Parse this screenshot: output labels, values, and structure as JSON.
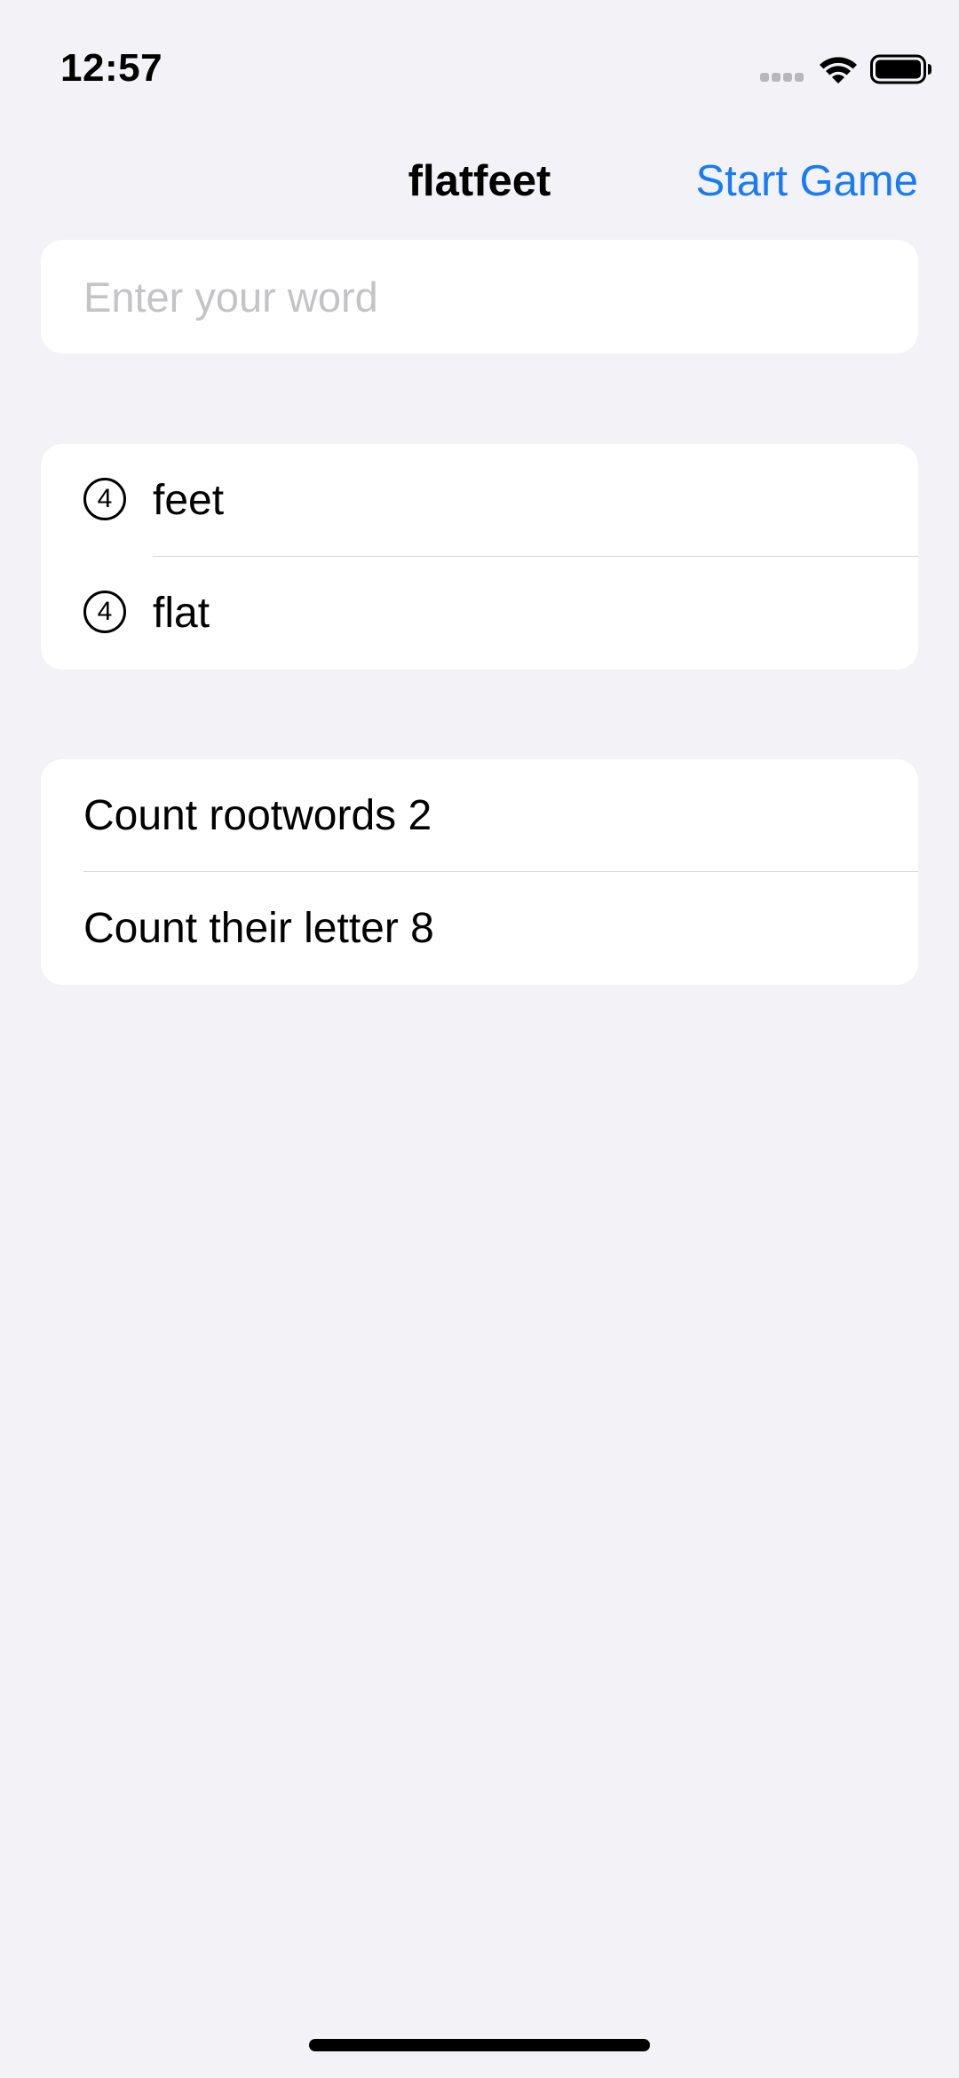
{
  "status_bar": {
    "time": "12:57",
    "icons": [
      "cellular-signal-icon",
      "wifi-icon",
      "battery-icon"
    ]
  },
  "nav": {
    "title": "flatfeet",
    "action_label": "Start Game"
  },
  "input": {
    "placeholder": "Enter your word",
    "value": ""
  },
  "words": [
    {
      "count": "4",
      "word": "feet"
    },
    {
      "count": "4",
      "word": "flat"
    }
  ],
  "stats": [
    {
      "label": "Count rootwords 2"
    },
    {
      "label": "Count their letter 8"
    }
  ],
  "colors": {
    "accent": "#1a7cf5",
    "background": "#f2f2f7",
    "card": "#ffffff",
    "placeholder": "#c4c4c7"
  }
}
